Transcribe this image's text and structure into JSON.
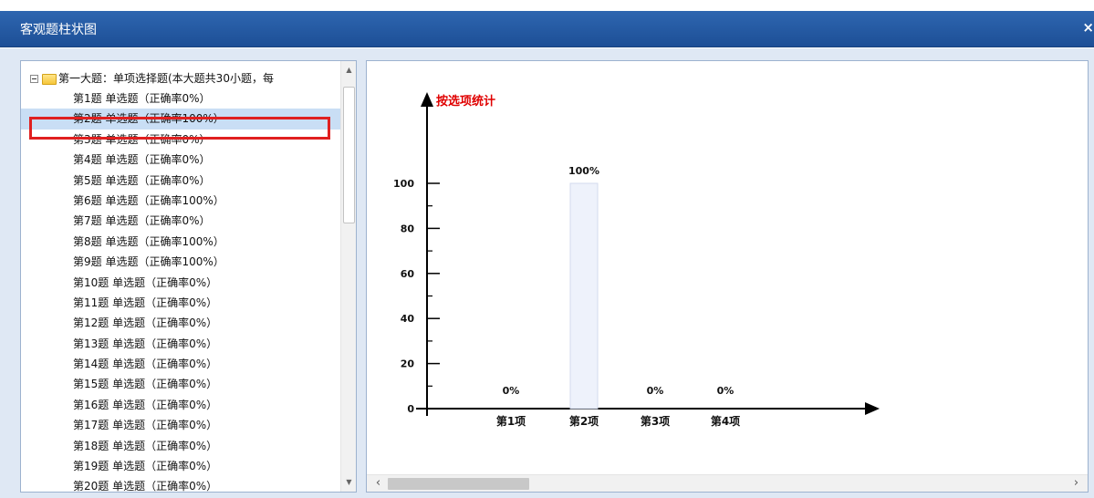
{
  "window": {
    "title": "客观题柱状图",
    "close_glyph": "×"
  },
  "tree": {
    "root_label": "第一大题：单项选择题(本大题共30小题，每",
    "selected_index": 1,
    "items": [
      "第1题 单选题（正确率0%）",
      "第2题 单选题（正确率100%）",
      "第3题 单选题（正确率0%）",
      "第4题 单选题（正确率0%）",
      "第5题 单选题（正确率0%）",
      "第6题 单选题（正确率100%）",
      "第7题 单选题（正确率0%）",
      "第8题 单选题（正确率100%）",
      "第9题 单选题（正确率100%）",
      "第10题 单选题（正确率0%）",
      "第11题 单选题（正确率0%）",
      "第12题 单选题（正确率0%）",
      "第13题 单选题（正确率0%）",
      "第14题 单选题（正确率0%）",
      "第15题 单选题（正确率0%）",
      "第16题 单选题（正确率0%）",
      "第17题 单选题（正确率0%）",
      "第18题 单选题（正确率0%）",
      "第19题 单选题（正确率0%）",
      "第20题 单选题（正确率0%）"
    ]
  },
  "chart_data": {
    "type": "bar",
    "title": "按选项统计",
    "title_color": "#e00000",
    "categories": [
      "第1项",
      "第2项",
      "第3项",
      "第4项"
    ],
    "values": [
      0,
      100,
      0,
      0
    ],
    "value_labels": [
      "0%",
      "100%",
      "0%",
      "0%"
    ],
    "ylim": [
      0,
      100
    ],
    "yticks": [
      0,
      20,
      40,
      60,
      80,
      100
    ],
    "grid": false,
    "legend": "none"
  }
}
